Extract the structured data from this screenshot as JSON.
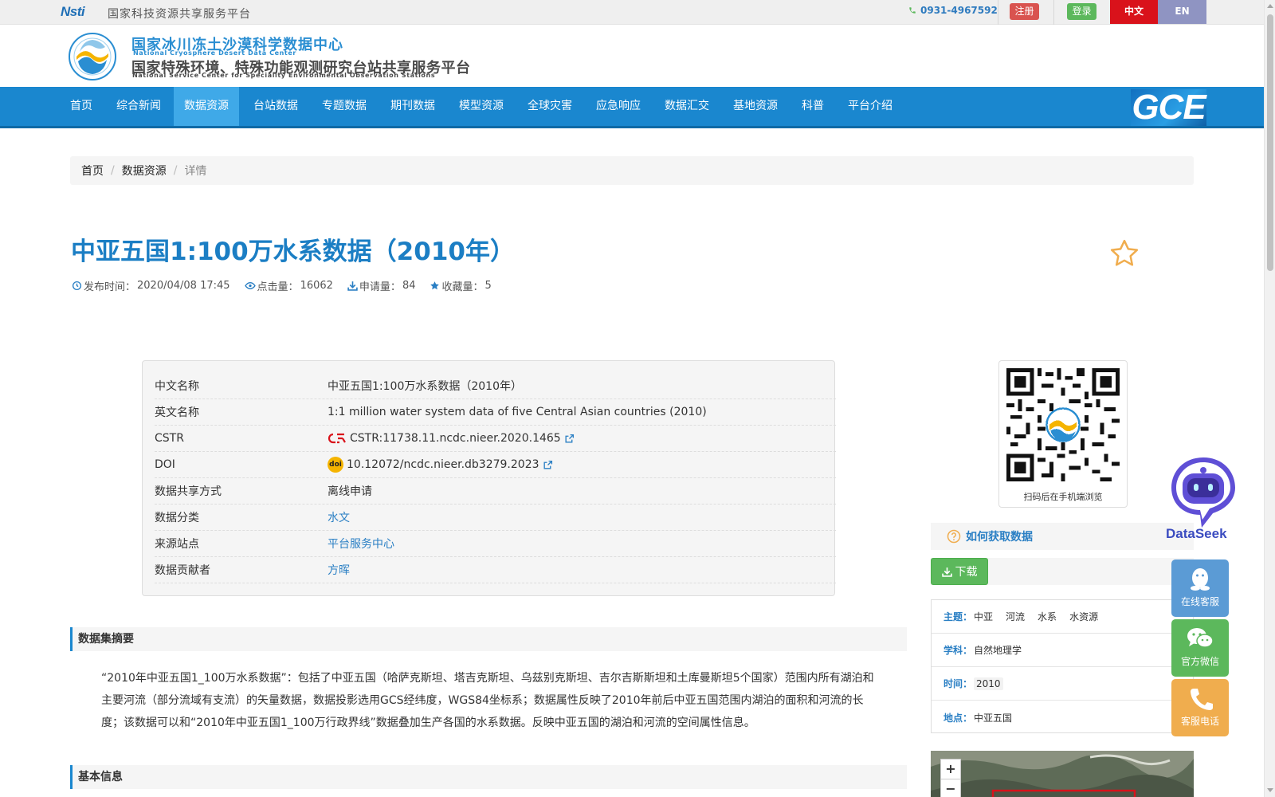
{
  "topbar": {
    "logo_text": "Nsti",
    "platform_name": "国家科技资源共享服务平台",
    "phone": "0931-4967592",
    "register_label": "注册",
    "login_label": "登录",
    "lang_zh": "中文",
    "lang_en": "EN"
  },
  "header": {
    "cn_title": "国家冰川冻土沙漠科学数据中心",
    "en_title": "National Cryosphere Desert Data Center",
    "cn_title2": "国家特殊环境、特殊功能观测研究台站共享服务平台",
    "en_title2": "National Service Center for Speciality Environmental Observation Stations"
  },
  "nav": {
    "items": [
      "首页",
      "综合新闻",
      "数据资源",
      "台站数据",
      "专题数据",
      "期刊数据",
      "模型资源",
      "全球灾害",
      "应急响应",
      "数据汇交",
      "基地资源",
      "科普",
      "平台介绍"
    ],
    "active": "数据资源",
    "gce_label": "GCE"
  },
  "breadcrumb": [
    "首页",
    "数据资源",
    "详情"
  ],
  "dataset": {
    "title": "中亚五国1:100万水系数据（2010年）",
    "meta": {
      "publish_label": "发布时间：",
      "publish_time": "2020/04/08 17:45",
      "views_label": "点击量：",
      "views": "16062",
      "applies_label": "申请量：",
      "applies": "84",
      "favs_label": "收藏量：",
      "favs": "5"
    },
    "info": [
      {
        "key": "中文名称",
        "value": "中亚五国1:100万水系数据（2010年）"
      },
      {
        "key": "英文名称",
        "value": "1:1 million water system data of five Central Asian countries (2010)"
      },
      {
        "key": "CSTR",
        "value": "CSTR:11738.11.ncdc.nieer.2020.1465"
      },
      {
        "key": "DOI",
        "value": "10.12072/ncdc.nieer.db3279.2023"
      },
      {
        "key": "数据共享方式",
        "value": "离线申请"
      },
      {
        "key": "数据分类",
        "value": "水文"
      },
      {
        "key": "来源站点",
        "value": "平台服务中心"
      },
      {
        "key": "数据贡献者",
        "value": "方晖"
      }
    ],
    "cstr_badge": "CSTR",
    "doi_badge": "doi"
  },
  "sections": {
    "abstract_title": "数据集摘要",
    "abstract_text": "“2010年中亚五国1_100万水系数据”：包括了中亚五国（哈萨克斯坦、塔吉克斯坦、乌兹别克斯坦、吉尔吉斯斯坦和土库曼斯坦5个国家）范围内所有湖泊和主要河流（部分流域有支流）的矢量数据，数据投影选用GCS经纬度，WGS84坐标系；数据属性反映了2010年前后中亚五国范围内湖泊的面积和河流的长度；该数据可以和“2010年中亚五国1_100万行政界线”数据叠加生产各国的水系数据。反映中亚五国的湖泊和河流的空间属性信息。",
    "basic_title": "基本信息"
  },
  "sidebar": {
    "qr_caption": "扫码后在手机端浏览",
    "how_label": "如何获取数据",
    "download_label": "下载",
    "topic_label": "主题：",
    "topics": [
      "中亚",
      "河流",
      "水系",
      "水资源"
    ],
    "subject_label": "学科：",
    "subject": "自然地理学",
    "time_label": "时间：",
    "time": "2010",
    "place_label": "地点：",
    "place": "中亚五国",
    "zoom_in": "+",
    "zoom_out": "−"
  },
  "floating": {
    "dataseek_label": "DataSeek",
    "online_service": "在线客服",
    "wechat": "官方微信",
    "phone_service": "客服电话"
  },
  "icons": [
    "phone-icon",
    "clock-icon",
    "eye-icon",
    "download-icon",
    "star-icon",
    "external-link-icon",
    "question-icon",
    "qq-icon",
    "wechat-icon",
    "phone-handset-icon",
    "robot-icon"
  ],
  "colors": {
    "brand_blue": "#1a87cf",
    "nav_active": "#3fa9e8",
    "register_red": "#d9534f",
    "login_green": "#5cb85c",
    "lang_zh_red": "#d9121b",
    "lang_en_purple": "#8f94c2",
    "title_blue": "#1b7ec4",
    "online_blue": "#5b9bd5",
    "wechat_green": "#5cb85c",
    "phone_orange": "#f0ad4e"
  }
}
